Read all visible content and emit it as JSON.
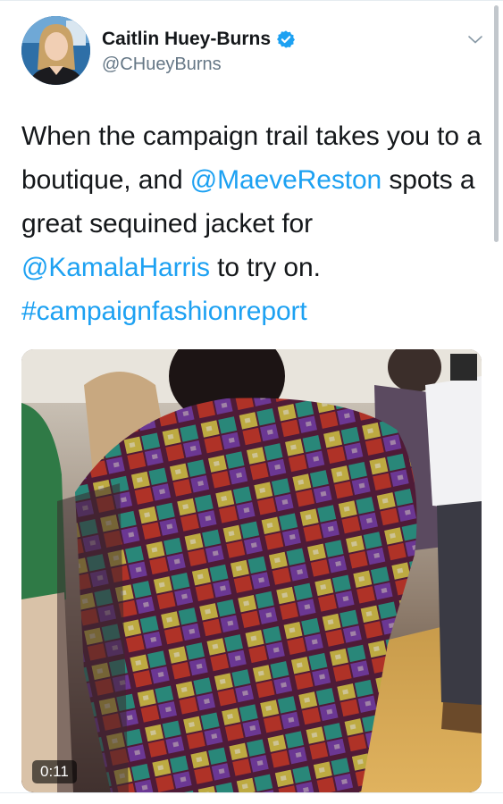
{
  "tweet": {
    "author": {
      "name": "Caitlin Huey-Burns",
      "handle": "@CHueyBurns",
      "verified": true
    },
    "text_parts": [
      {
        "text": "When the campaign trail takes you to a boutique, and ",
        "type": "text"
      },
      {
        "text": "@MaeveReston",
        "type": "mention"
      },
      {
        "text": " spots a great sequined jacket for ",
        "type": "text"
      },
      {
        "text": "@KamalaHarris",
        "type": "mention"
      },
      {
        "text": " to try on. ",
        "type": "text"
      },
      {
        "text": "#campaignfashionreport",
        "type": "hashtag"
      }
    ],
    "media": {
      "kind": "video",
      "duration": "0:11"
    }
  },
  "icons": {
    "verified": "verified-badge-icon",
    "menu": "chevron-down-icon"
  },
  "colors": {
    "link": "#1da1f2",
    "secondary_text": "#657786",
    "primary_text": "#14171a"
  }
}
